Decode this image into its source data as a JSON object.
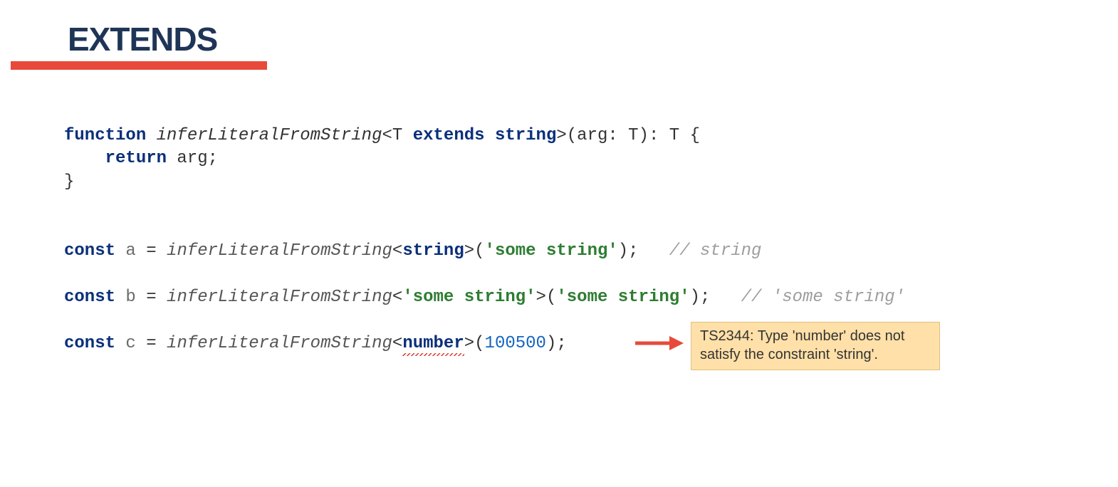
{
  "header": {
    "title": "EXTENDS"
  },
  "code": {
    "l1": {
      "kw1": "function",
      "name": " inferLiteralFromString",
      "lt": "<T ",
      "kw2": "extends",
      "sp": " ",
      "ty": "string",
      "gt": ">(arg: T): T {"
    },
    "l2": {
      "kw": "return",
      "rest": " arg;"
    },
    "l3": "}",
    "la": {
      "kw": "const",
      "var": " a ",
      "eq": "= ",
      "fn": "inferLiteralFromString",
      "lt": "<",
      "ty": "string",
      "gt": ">(",
      "str": "'some string'",
      "end": ");",
      "cm": "   // string"
    },
    "lb": {
      "kw": "const",
      "var": " b ",
      "eq": "= ",
      "fn": "inferLiteralFromString",
      "lt": "<",
      "str1": "'some string'",
      "gt": ">(",
      "str2": "'some string'",
      "end": ");",
      "cm": "   // 'some string'"
    },
    "lc": {
      "kw": "const",
      "var": " c ",
      "eq": "= ",
      "fn": "inferLiteralFromString",
      "lt": "<",
      "ty": "number",
      "gt": ">(",
      "num": "100500",
      "end": ");"
    }
  },
  "tooltip": {
    "text": "TS2344: Type 'number' does not satisfy the constraint 'string'."
  }
}
